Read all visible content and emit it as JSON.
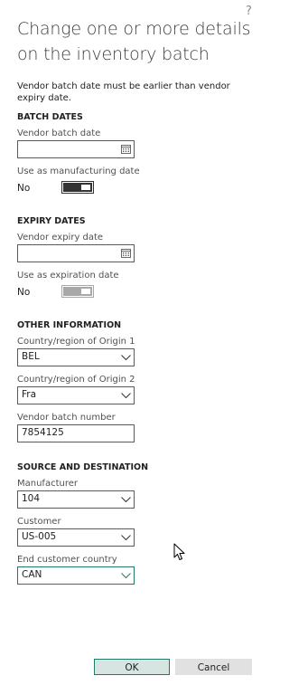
{
  "dialog": {
    "help_glyph": "?",
    "title": "Change one or more details on the inventory batch",
    "info": "Vendor batch date must be earlier than vendor expiry date."
  },
  "batch_dates": {
    "heading": "BATCH DATES",
    "vendor_batch_date": {
      "label": "Vendor batch date",
      "value": ""
    },
    "use_as_manufacturing": {
      "label": "Use as manufacturing date",
      "state_text": "No",
      "on": false,
      "enabled": true
    }
  },
  "expiry_dates": {
    "heading": "EXPIRY DATES",
    "vendor_expiry_date": {
      "label": "Vendor expiry date",
      "value": ""
    },
    "use_as_expiration": {
      "label": "Use as expiration date",
      "state_text": "No",
      "on": false,
      "enabled": false
    }
  },
  "other_information": {
    "heading": "OTHER INFORMATION",
    "origin1": {
      "label": "Country/region of Origin 1",
      "value": "BEL"
    },
    "origin2": {
      "label": "Country/region of Origin 2",
      "value": "Fra"
    },
    "vendor_batch_number": {
      "label": "Vendor batch number",
      "value": "7854125"
    }
  },
  "source_destination": {
    "heading": "SOURCE AND DESTINATION",
    "manufacturer": {
      "label": "Manufacturer",
      "value": "104"
    },
    "customer": {
      "label": "Customer",
      "value": "US-005"
    },
    "end_customer_country": {
      "label": "End customer country",
      "value": "CAN"
    }
  },
  "buttons": {
    "ok": "OK",
    "cancel": "Cancel"
  },
  "colors": {
    "accent": "#1f7a6b",
    "ok_bg": "#d6e4e2",
    "cancel_bg": "#e1e1e1"
  },
  "icons": {
    "calendar": "calendar-icon",
    "dropdown": "chevron-down-icon",
    "pointer": "mouse-cursor-icon"
  }
}
